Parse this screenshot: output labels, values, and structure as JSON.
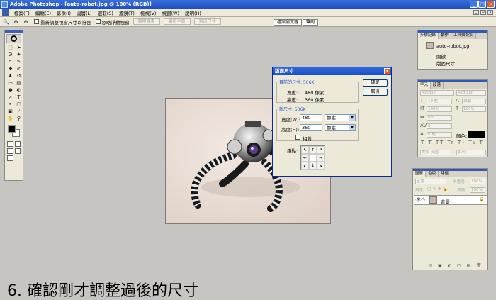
{
  "window": {
    "title": "Adobe Photoshop - [auto-robot.jpg @ 100% (RGB)]"
  },
  "menu": [
    "檔案(F)",
    "編輯(E)",
    "影像(I)",
    "圖層(L)",
    "選取(S)",
    "濾鏡(T)",
    "檢視(V)",
    "視窗(W)",
    "說明(H)"
  ],
  "options": {
    "zoom_labels": [
      "🔍",
      "⊕",
      "⊖"
    ],
    "checkbox1_label": "重新調整視窗尺寸以符合",
    "checkbox2_label": "忽略浮動視窗",
    "buttons": [
      "實際像素",
      "顯示全頁",
      "列印尺寸"
    ],
    "well_tabs": [
      "檔案瀏覽器",
      "筆刷"
    ]
  },
  "dialog": {
    "title": "版面尺寸",
    "current": {
      "legend": "目前的尺寸: 506K",
      "width_label": "寬度:",
      "width_value": "480 像素",
      "height_label": "高度:",
      "height_value": "360 像素"
    },
    "new": {
      "legend": "新尺寸: 506K",
      "width_label": "寬度(W):",
      "width_value": "480",
      "width_unit": "像素",
      "height_label": "高度(H):",
      "height_value": "360",
      "height_unit": "像素",
      "relative_label": "相對",
      "anchor_label": "錨點:",
      "anchor_arrows": [
        "↖",
        "↑",
        "↗",
        "←",
        "",
        "→",
        "↙",
        "↓",
        "↘"
      ]
    },
    "ok_label": "確定",
    "cancel_label": "取消"
  },
  "history_panel": {
    "tabs": [
      "步驟記錄",
      "動作",
      "工具預設集"
    ],
    "snapshot_label": "auto-robot.jpg",
    "items": [
      "開啟",
      "版面尺寸"
    ]
  },
  "character_panel": {
    "tabs": [
      "字元",
      "段落"
    ],
    "font_family": "Mingall",
    "font_style": "Regular",
    "size": "10 點",
    "leading": "自動",
    "scale_v": "100%",
    "scale_h": "100%",
    "tracking": "0%",
    "kerning": "0",
    "baseline": "0 點",
    "color_label": "顏色:",
    "language": "美式 英國",
    "aa": "銳利"
  },
  "layers_panel": {
    "tabs": [
      "圖層",
      "色版",
      "路徑"
    ],
    "blend_mode": "正常",
    "opacity_label": "不透明",
    "opacity": "100%",
    "lock_label": "鎖定:",
    "fill_label": "填滿",
    "fill": "100%",
    "layer_name": "背景"
  },
  "caption": "6. 確認剛才調整過後的尺寸",
  "colors": {
    "titlebar": "#1d4fc4",
    "canvas_bg": "#c7c5c2",
    "dialog_bg": "#ece9d8"
  }
}
